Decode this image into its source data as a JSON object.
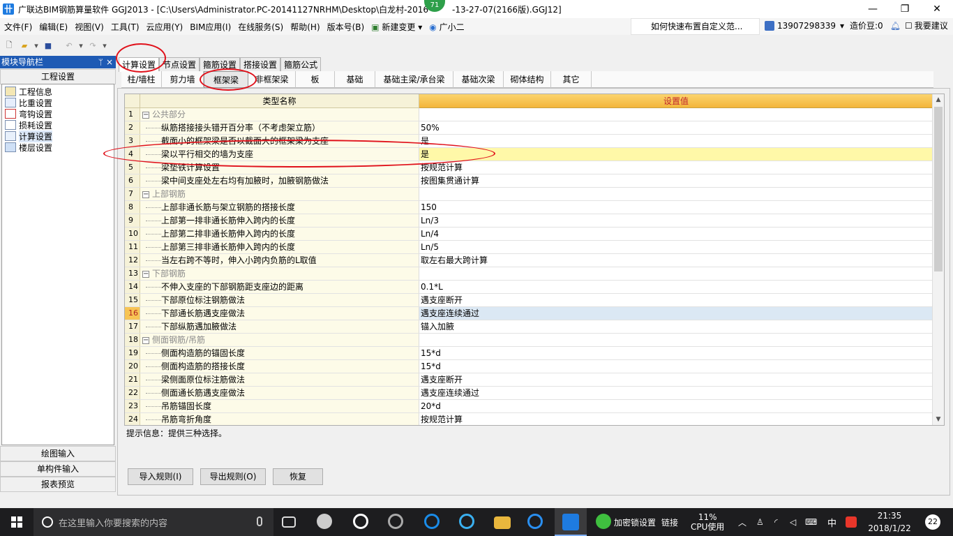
{
  "window": {
    "title": "广联达BIM钢筋算量软件 GGJ2013 - [C:\\Users\\Administrator.PC-20141127NRHM\\Desktop\\白龙村-2016",
    "title_tail": "-13-27-07(2166版).GGJ12]",
    "badge": "71",
    "minimize": "—",
    "maximize": "❐",
    "close": "✕"
  },
  "menu": {
    "items": [
      "文件(F)",
      "编辑(E)",
      "视图(V)",
      "工具(T)",
      "云应用(Y)",
      "BIM应用(I)",
      "在线服务(S)",
      "帮助(H)",
      "版本号(B)"
    ],
    "new_change": "新建变更",
    "assistant": "广小二",
    "help_search": "如何快速布置自定义范...",
    "phone": "13907298339",
    "price_bean": "造价豆:0",
    "suggest": "我要建议"
  },
  "nav": {
    "header": "模块导航栏",
    "pin": "ᛘ",
    "close": "×",
    "section_top": "工程设置",
    "tree": [
      "工程信息",
      "比重设置",
      "弯钩设置",
      "损耗设置",
      "计算设置",
      "楼层设置"
    ],
    "selected": "计算设置",
    "bottom": [
      "绘图输入",
      "单构件输入",
      "报表预览"
    ]
  },
  "tabs1": [
    "计算设置",
    "节点设置",
    "箍筋设置",
    "搭接设置",
    "箍筋公式"
  ],
  "tabs2": [
    "柱/墙柱",
    "剪力墙",
    "框架梁",
    "非框架梁",
    "板",
    "基础",
    "基础主梁/承台梁",
    "基础次梁",
    "砌体结构",
    "其它"
  ],
  "grid": {
    "col_name": "类型名称",
    "col_value": "设置值",
    "rows": [
      {
        "idx": "1",
        "name": "公共部分",
        "value": "",
        "group": true
      },
      {
        "idx": "2",
        "name": "纵筋搭接接头错开百分率（不考虑架立筋）",
        "value": "50%"
      },
      {
        "idx": "3",
        "name": "截面小的框架梁是否以截面大的框架梁为支座",
        "value": "是"
      },
      {
        "idx": "4",
        "name": "梁以平行相交的墙为支座",
        "value": "是",
        "highlight": true
      },
      {
        "idx": "5",
        "name": "梁垫铁计算设置",
        "value": "按规范计算"
      },
      {
        "idx": "6",
        "name": "梁中间支座处左右均有加腋时，加腋钢筋做法",
        "value": "按图集贯通计算"
      },
      {
        "idx": "7",
        "name": "上部钢筋",
        "value": "",
        "group": true
      },
      {
        "idx": "8",
        "name": "上部非通长筋与架立钢筋的搭接长度",
        "value": "150"
      },
      {
        "idx": "9",
        "name": "上部第一排非通长筋伸入跨内的长度",
        "value": "Ln/3"
      },
      {
        "idx": "10",
        "name": "上部第二排非通长筋伸入跨内的长度",
        "value": "Ln/4"
      },
      {
        "idx": "11",
        "name": "上部第三排非通长筋伸入跨内的长度",
        "value": "Ln/5"
      },
      {
        "idx": "12",
        "name": "当左右跨不等时，伸入小跨内负筋的L取值",
        "value": "取左右最大跨计算"
      },
      {
        "idx": "13",
        "name": "下部钢筋",
        "value": "",
        "group": true
      },
      {
        "idx": "14",
        "name": "不伸入支座的下部钢筋距支座边的距离",
        "value": "0.1*L"
      },
      {
        "idx": "15",
        "name": "下部原位标注钢筋做法",
        "value": "遇支座断开"
      },
      {
        "idx": "16",
        "name": "下部通长筋遇支座做法",
        "value": "遇支座连续通过",
        "current": true
      },
      {
        "idx": "17",
        "name": "下部纵筋遇加腋做法",
        "value": "锚入加腋"
      },
      {
        "idx": "18",
        "name": "侧面钢筋/吊筋",
        "value": "",
        "group": true
      },
      {
        "idx": "19",
        "name": "侧面构造筋的锚固长度",
        "value": "15*d"
      },
      {
        "idx": "20",
        "name": "侧面构造筋的搭接长度",
        "value": "15*d"
      },
      {
        "idx": "21",
        "name": "梁侧面原位标注筋做法",
        "value": "遇支座断开"
      },
      {
        "idx": "22",
        "name": "侧面通长筋遇支座做法",
        "value": "遇支座连续通过"
      },
      {
        "idx": "23",
        "name": "吊筋锚固长度",
        "value": "20*d"
      },
      {
        "idx": "24",
        "name": "吊筋弯折角度",
        "value": "按规范计算"
      }
    ]
  },
  "hint": "提示信息：提供三种选择。",
  "buttons": [
    "导入规则(I)",
    "导出规则(O)",
    "恢复"
  ],
  "taskbar": {
    "search_placeholder": "在这里输入你要搜索的内容",
    "encrypt": "加密锁设置",
    "link": "链接",
    "cpu_pct": "11%",
    "cpu_label": "CPU使用",
    "ime": "中",
    "time": "21:35",
    "date": "2018/1/22",
    "notifications": "22"
  }
}
